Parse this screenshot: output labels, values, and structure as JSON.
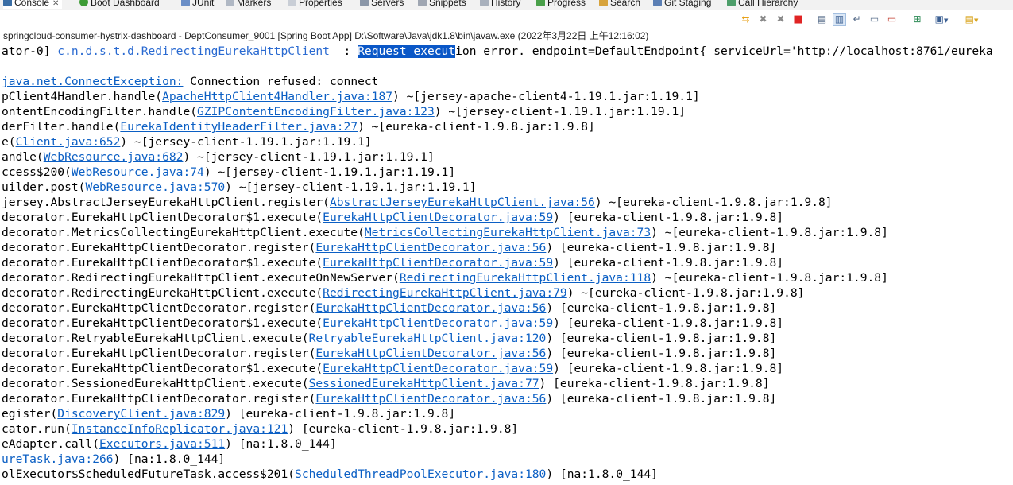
{
  "tabs": [
    {
      "label": "Console",
      "icon": "console-icon",
      "active": true
    },
    {
      "label": "Boot Dashboard",
      "icon": "boot-dashboard-icon"
    },
    {
      "label": "JUnit",
      "icon": "junit-icon"
    },
    {
      "label": "Markers",
      "icon": "markers-icon"
    },
    {
      "label": "Properties",
      "icon": "properties-icon"
    },
    {
      "label": "Servers",
      "icon": "servers-icon"
    },
    {
      "label": "Snippets",
      "icon": "snippets-icon"
    },
    {
      "label": "History",
      "icon": "history-icon"
    },
    {
      "label": "Progress",
      "icon": "progress-icon"
    },
    {
      "label": "Search",
      "icon": "search-icon"
    },
    {
      "label": "Git Staging",
      "icon": "git-staging-icon"
    },
    {
      "label": "Call Hierarchy",
      "icon": "call-hierarchy-icon"
    }
  ],
  "process_title": "springcloud-consumer-hystrix-dashboard - DeptConsumer_9001 [Spring Boot App] D:\\Software\\Java\\jdk1.8\\bin\\javaw.exe  (2022年3月22日 上午12:16:02)",
  "toolbar_icons": [
    "sync-icon",
    "remove-launch-icon",
    "remove-all-icon",
    "terminate-icon",
    "clear-console-icon",
    "scroll-lock-icon",
    "word-wrap-icon",
    "show-on-output-icon",
    "show-on-error-icon",
    "pin-console-icon",
    "display-console-icon",
    "open-console-icon"
  ],
  "accent_colors": {
    "link": "#0b5fc4",
    "selection": "#0a57c7",
    "terminate": "#e02424",
    "sync": "#e8a21a"
  },
  "console_lines": [
    [
      {
        "t": "ator-0] "
      },
      {
        "t": "c.n.d.s.t.d.RedirectingEurekaHttpClient",
        "c": "cls"
      },
      {
        "t": "  : "
      },
      {
        "t": "Request execut",
        "c": "sel"
      },
      {
        "t": "ion error. endpoint=DefaultEndpoint{ serviceUrl='http://localhost:8761/eureka"
      }
    ],
    [
      {
        "t": ""
      }
    ],
    [
      {
        "t": "java.net.ConnectException:",
        "c": "lnk"
      },
      {
        "t": " Connection refused: connect"
      }
    ],
    [
      {
        "t": "pClient4Handler.handle("
      },
      {
        "t": "ApacheHttpClient4Handler.java:187",
        "c": "lnk"
      },
      {
        "t": ") ~[jersey-apache-client4-1.19.1.jar:1.19.1]"
      }
    ],
    [
      {
        "t": "ontentEncodingFilter.handle("
      },
      {
        "t": "GZIPContentEncodingFilter.java:123",
        "c": "lnk"
      },
      {
        "t": ") ~[jersey-client-1.19.1.jar:1.19.1]"
      }
    ],
    [
      {
        "t": "derFilter.handle("
      },
      {
        "t": "EurekaIdentityHeaderFilter.java:27",
        "c": "lnk"
      },
      {
        "t": ") ~[eureka-client-1.9.8.jar:1.9.8]"
      }
    ],
    [
      {
        "t": "e("
      },
      {
        "t": "Client.java:652",
        "c": "lnk"
      },
      {
        "t": ") ~[jersey-client-1.19.1.jar:1.19.1]"
      }
    ],
    [
      {
        "t": "andle("
      },
      {
        "t": "WebResource.java:682",
        "c": "lnk"
      },
      {
        "t": ") ~[jersey-client-1.19.1.jar:1.19.1]"
      }
    ],
    [
      {
        "t": "ccess$200("
      },
      {
        "t": "WebResource.java:74",
        "c": "lnk"
      },
      {
        "t": ") ~[jersey-client-1.19.1.jar:1.19.1]"
      }
    ],
    [
      {
        "t": "uilder.post("
      },
      {
        "t": "WebResource.java:570",
        "c": "lnk"
      },
      {
        "t": ") ~[jersey-client-1.19.1.jar:1.19.1]"
      }
    ],
    [
      {
        "t": "jersey.AbstractJerseyEurekaHttpClient.register("
      },
      {
        "t": "AbstractJerseyEurekaHttpClient.java:56",
        "c": "lnk"
      },
      {
        "t": ") ~[eureka-client-1.9.8.jar:1.9.8]"
      }
    ],
    [
      {
        "t": "decorator.EurekaHttpClientDecorator$1.execute("
      },
      {
        "t": "EurekaHttpClientDecorator.java:59",
        "c": "lnk"
      },
      {
        "t": ") [eureka-client-1.9.8.jar:1.9.8]"
      }
    ],
    [
      {
        "t": "decorator.MetricsCollectingEurekaHttpClient.execute("
      },
      {
        "t": "MetricsCollectingEurekaHttpClient.java:73",
        "c": "lnk"
      },
      {
        "t": ") ~[eureka-client-1.9.8.jar:1.9.8]"
      }
    ],
    [
      {
        "t": "decorator.EurekaHttpClientDecorator.register("
      },
      {
        "t": "EurekaHttpClientDecorator.java:56",
        "c": "lnk"
      },
      {
        "t": ") [eureka-client-1.9.8.jar:1.9.8]"
      }
    ],
    [
      {
        "t": "decorator.EurekaHttpClientDecorator$1.execute("
      },
      {
        "t": "EurekaHttpClientDecorator.java:59",
        "c": "lnk"
      },
      {
        "t": ") [eureka-client-1.9.8.jar:1.9.8]"
      }
    ],
    [
      {
        "t": "decorator.RedirectingEurekaHttpClient.executeOnNewServer("
      },
      {
        "t": "RedirectingEurekaHttpClient.java:118",
        "c": "lnk"
      },
      {
        "t": ") ~[eureka-client-1.9.8.jar:1.9.8]"
      }
    ],
    [
      {
        "t": "decorator.RedirectingEurekaHttpClient.execute("
      },
      {
        "t": "RedirectingEurekaHttpClient.java:79",
        "c": "lnk"
      },
      {
        "t": ") ~[eureka-client-1.9.8.jar:1.9.8]"
      }
    ],
    [
      {
        "t": "decorator.EurekaHttpClientDecorator.register("
      },
      {
        "t": "EurekaHttpClientDecorator.java:56",
        "c": "lnk"
      },
      {
        "t": ") [eureka-client-1.9.8.jar:1.9.8]"
      }
    ],
    [
      {
        "t": "decorator.EurekaHttpClientDecorator$1.execute("
      },
      {
        "t": "EurekaHttpClientDecorator.java:59",
        "c": "lnk"
      },
      {
        "t": ") [eureka-client-1.9.8.jar:1.9.8]"
      }
    ],
    [
      {
        "t": "decorator.RetryableEurekaHttpClient.execute("
      },
      {
        "t": "RetryableEurekaHttpClient.java:120",
        "c": "lnk"
      },
      {
        "t": ") [eureka-client-1.9.8.jar:1.9.8]"
      }
    ],
    [
      {
        "t": "decorator.EurekaHttpClientDecorator.register("
      },
      {
        "t": "EurekaHttpClientDecorator.java:56",
        "c": "lnk"
      },
      {
        "t": ") [eureka-client-1.9.8.jar:1.9.8]"
      }
    ],
    [
      {
        "t": "decorator.EurekaHttpClientDecorator$1.execute("
      },
      {
        "t": "EurekaHttpClientDecorator.java:59",
        "c": "lnk"
      },
      {
        "t": ") [eureka-client-1.9.8.jar:1.9.8]"
      }
    ],
    [
      {
        "t": "decorator.SessionedEurekaHttpClient.execute("
      },
      {
        "t": "SessionedEurekaHttpClient.java:77",
        "c": "lnk"
      },
      {
        "t": ") [eureka-client-1.9.8.jar:1.9.8]"
      }
    ],
    [
      {
        "t": "decorator.EurekaHttpClientDecorator.register("
      },
      {
        "t": "EurekaHttpClientDecorator.java:56",
        "c": "lnk"
      },
      {
        "t": ") [eureka-client-1.9.8.jar:1.9.8]"
      }
    ],
    [
      {
        "t": "egister("
      },
      {
        "t": "DiscoveryClient.java:829",
        "c": "lnk"
      },
      {
        "t": ") [eureka-client-1.9.8.jar:1.9.8]"
      }
    ],
    [
      {
        "t": "cator.run("
      },
      {
        "t": "InstanceInfoReplicator.java:121",
        "c": "lnk"
      },
      {
        "t": ") [eureka-client-1.9.8.jar:1.9.8]"
      }
    ],
    [
      {
        "t": "eAdapter.call("
      },
      {
        "t": "Executors.java:511",
        "c": "lnk"
      },
      {
        "t": ") [na:1.8.0_144]"
      }
    ],
    [
      {
        "t": "ureTask.java:266",
        "c": "lnk"
      },
      {
        "t": ") [na:1.8.0_144]"
      }
    ],
    [
      {
        "t": "olExecutor$ScheduledFutureTask.access$201("
      },
      {
        "t": "ScheduledThreadPoolExecutor.java:180",
        "c": "lnk"
      },
      {
        "t": ") [na:1.8.0_144]"
      }
    ]
  ]
}
